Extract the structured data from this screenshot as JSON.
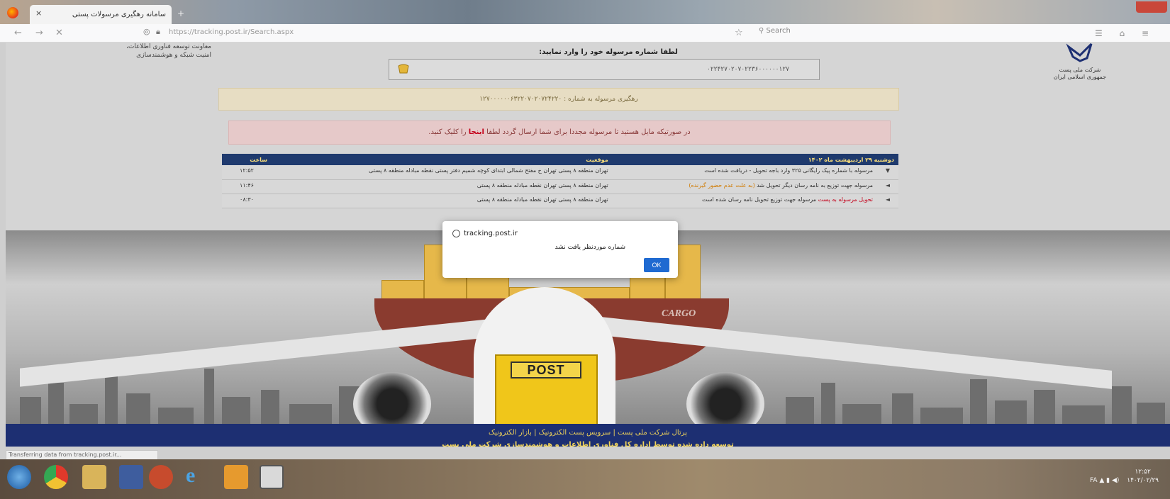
{
  "browser": {
    "tab_title": "سامانه رهگیری مرسولات پستی",
    "tab_close": "×",
    "new_tab": "+",
    "url": "https://tracking.post.ir/Search.aspx",
    "search_placeholder": "Search",
    "nav_back": "←",
    "nav_forward": "→",
    "nav_stop": "✕",
    "toolbar_icons": "☰ ⌂ ≡",
    "star": "☆"
  },
  "header": {
    "left_text_line1": "معاونت توسعه فناوری اطلاعات،",
    "left_text_line2": "امنیت شبکه و هوشمندسازی",
    "logo_line1": "شرکت ملی پست",
    "logo_line2": "جمهوری اسلامی ایران"
  },
  "search": {
    "prompt": "لطفا شماره مرسوله خود را وارد نمایید:",
    "value": "۰۲۲۴۲۷۰۲۰۷۰۲۲۳۶۰۰۰۰۰۰۱۲۷"
  },
  "result_banner": "رهگیری مرسوله به شماره : ۱۲۷۰۰۰۰۰۰۶۳۲۲۰۷۰۲۰۷۲۴۲۲۰",
  "alert": {
    "text": "در صورتیکه مایل هستید تا مرسوله مجددا برای شما ارسال گردد لطفا",
    "link": "اینجا",
    "suffix": "را کلیک کنید."
  },
  "table": {
    "headers": {
      "event": "دوشنبه ۲۹ اردیبهشت ماه ۱۴۰۲",
      "location": "موقعیت",
      "time": "ساعت"
    },
    "rows": [
      {
        "arrow": "▼",
        "event": "مرسوله با شماره پیک رایگانی ۳۲۵ وارد باجه تحویل - دریافت شده است",
        "event_hl": "",
        "location": "تهران منطقه ۸ پستی تهران خ مفتح شمالی ابتدای کوچه شمیم دفتر پستی نقطه مبادله منطقه ۸ پستی",
        "time": "۱۲:۵۲"
      },
      {
        "arrow": "◄",
        "event": "مرسوله جهت توزیع به نامه رسان دیگر تحویل شد",
        "event_hl": " (به علت عدم حضور گیرنده)",
        "location": "تهران منطقه ۸ پستی تهران نقطه مبادله منطقه ۸ پستی",
        "time": "۱۱:۴۶"
      },
      {
        "arrow": "◄",
        "event": "تحویل مرسوله به پست",
        "event_hl": " مرسوله جهت توزیع تحویل نامه رسان شده است",
        "location": "تهران منطقه ۸ پستی تهران نقطه مبادله منطقه ۸ پستی",
        "time": "۰۸:۳۰"
      }
    ]
  },
  "hero": {
    "post_sign": "POST",
    "cargo": "CARGO"
  },
  "footer": {
    "links": "پرتال شرکت ملی پست | سرویس پست الکترونیک | بازار الکترونیک",
    "copyright": "توسعه داده شده توسط اداره کل فناوری اطلاعات و هوشمندسازی شرکت ملی پست"
  },
  "status_bar": "Transferring data from tracking.post.ir...",
  "dialog": {
    "site": "tracking.post.ir",
    "message": "شماره موردنظر یافت نشد",
    "ok": "OK"
  },
  "taskbar": {
    "tray_text": "FA",
    "time": "۱۲:۵۲",
    "date": "۱۴۰۲/۰۲/۲۹"
  },
  "colors": {
    "footer_bg": "#1d2f72",
    "table_header_bg": "#1f3a6e",
    "ok_button": "#1f6ad1",
    "alert_link": "#c4001a"
  }
}
